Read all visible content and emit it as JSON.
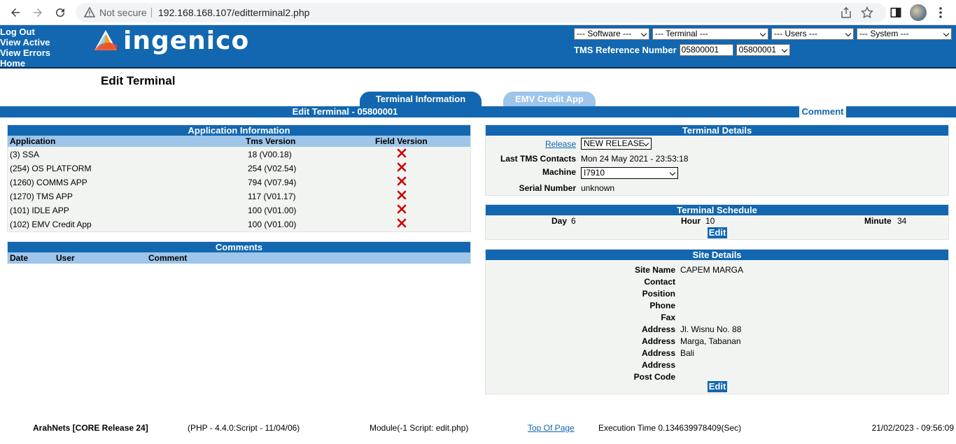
{
  "browser": {
    "security_label": "Not secure",
    "url": "192.168.168.107/editterminal2.php"
  },
  "header": {
    "links": [
      "Log Out",
      "View Active",
      "View Errors",
      "Home"
    ],
    "logo_text": "ingenico",
    "menus": [
      "--- Software ---",
      "--- Terminal ---",
      "--- Users ---",
      "--- System ---"
    ],
    "tms_label": "TMS Reference Number",
    "tms_input": "05800001",
    "tms_select": "05800001"
  },
  "page": {
    "title": "Edit Terminal",
    "tabs": [
      "Terminal Information",
      "EMV Credit App"
    ],
    "bar_title": "Edit Terminal - 05800001",
    "comment_button": "Comment"
  },
  "app_info": {
    "heading": "Application Information",
    "columns": [
      "Application",
      "Tms Version",
      "Field Version"
    ],
    "rows": [
      {
        "application": "(3) SSA",
        "tms_version": "18 (V00.18)"
      },
      {
        "application": "(254) OS PLATFORM",
        "tms_version": "254 (V02.54)"
      },
      {
        "application": "(1260) COMMS APP",
        "tms_version": "794 (V07.94)"
      },
      {
        "application": "(1270) TMS APP",
        "tms_version": "117 (V01.17)"
      },
      {
        "application": "(101) IDLE APP",
        "tms_version": "100 (V01.00)"
      },
      {
        "application": "(102) EMV Credit App",
        "tms_version": "100 (V01.00)"
      }
    ]
  },
  "comments": {
    "heading": "Comments",
    "columns": [
      "Date",
      "User",
      "Comment"
    ]
  },
  "terminal_details": {
    "heading": "Terminal Details",
    "release_label": "Release",
    "release_value": "NEW RELEASE",
    "last_contact_label": "Last TMS Contacts",
    "last_contact_value": "Mon 24 May 2021 - 23:53:18",
    "machine_label": "Machine",
    "machine_value": "I7910",
    "serial_label": "Serial Number",
    "serial_value": "unknown"
  },
  "schedule": {
    "heading": "Terminal Schedule",
    "day_label": "Day",
    "day_value": "6",
    "hour_label": "Hour",
    "hour_value": "10",
    "minute_label": "Minute",
    "minute_value": "34",
    "edit_label": "Edit"
  },
  "site": {
    "heading": "Site Details",
    "rows": [
      {
        "label": "Site Name",
        "value": "CAPEM MARGA"
      },
      {
        "label": "Contact",
        "value": ""
      },
      {
        "label": "Position",
        "value": ""
      },
      {
        "label": "Phone",
        "value": ""
      },
      {
        "label": "Fax",
        "value": ""
      },
      {
        "label": "Address",
        "value": "Jl. Wisnu No. 88"
      },
      {
        "label": "Address",
        "value": "Marga, Tabanan"
      },
      {
        "label": "Address",
        "value": "Bali"
      },
      {
        "label": "Address",
        "value": ""
      },
      {
        "label": "Post Code",
        "value": ""
      }
    ],
    "edit_label": "Edit"
  },
  "footer": {
    "release": "ArahNets [CORE Release 24]",
    "php": "(PHP - 4.4.0:Script - 11/04/06)",
    "module": "Module(-1 Script: edit.php)",
    "top_link": "Top Of Page",
    "exec_time": "Execution Time 0.134639978409(Sec)",
    "datetime": "21/02/2023 - 09:56:09"
  },
  "colors": {
    "header_blue": "#1267b0",
    "light_blue": "#9ec5ea",
    "error_red": "#cc0000"
  }
}
